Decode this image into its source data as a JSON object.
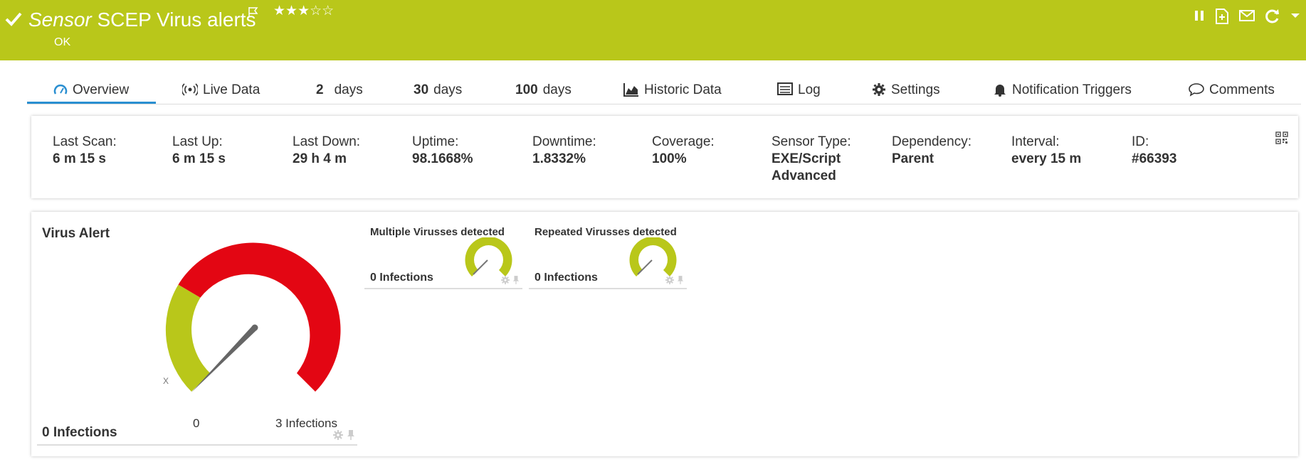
{
  "header": {
    "title_em": "Sensor",
    "title_rest": "SCEP Virus alerts",
    "stars": "★★★☆☆",
    "status": "OK",
    "icons": [
      "pause-icon",
      "add-page-icon",
      "mail-icon",
      "refresh-icon",
      "chevron-down-icon"
    ],
    "accent": "#b9c71a"
  },
  "tabs": [
    {
      "label": "Overview",
      "active": true
    },
    {
      "label": "Live Data"
    },
    {
      "num": "2",
      "label": "days"
    },
    {
      "num": "30",
      "label": "days"
    },
    {
      "num": "100",
      "label": "days"
    },
    {
      "label": "Historic Data"
    },
    {
      "label": "Log"
    },
    {
      "label": "Settings"
    },
    {
      "label": "Notification Triggers"
    },
    {
      "label": "Comments"
    }
  ],
  "info": [
    {
      "k": "Last Scan:",
      "v": "6 m 15 s"
    },
    {
      "k": "Last Up:",
      "v": "6 m 15 s"
    },
    {
      "k": "Last Down:",
      "v": "29 h 4 m"
    },
    {
      "k": "Uptime:",
      "v": "98.1668%"
    },
    {
      "k": "Downtime:",
      "v": "1.8332%"
    },
    {
      "k": "Coverage:",
      "v": "100%"
    },
    {
      "k": "Sensor Type:",
      "v": "EXE/Script",
      "v2": "Advanced"
    },
    {
      "k": "Dependency:",
      "v": "Parent"
    },
    {
      "k": "Interval:",
      "v": "every 15 m"
    },
    {
      "k": "ID:",
      "v": "#66393"
    }
  ],
  "main_gauge": {
    "title": "Virus Alert",
    "value": "0 Infections",
    "min_label": "0",
    "max_label": "3 Infections",
    "marker": "X",
    "ok_color": "#b9c71a",
    "alert_color": "#e30613"
  },
  "mini_gauges": [
    {
      "title": "Multiple Virusses detected",
      "value": "0 Infections"
    },
    {
      "title": "Repeated Virusses detected",
      "value": "0 Infections"
    }
  ]
}
